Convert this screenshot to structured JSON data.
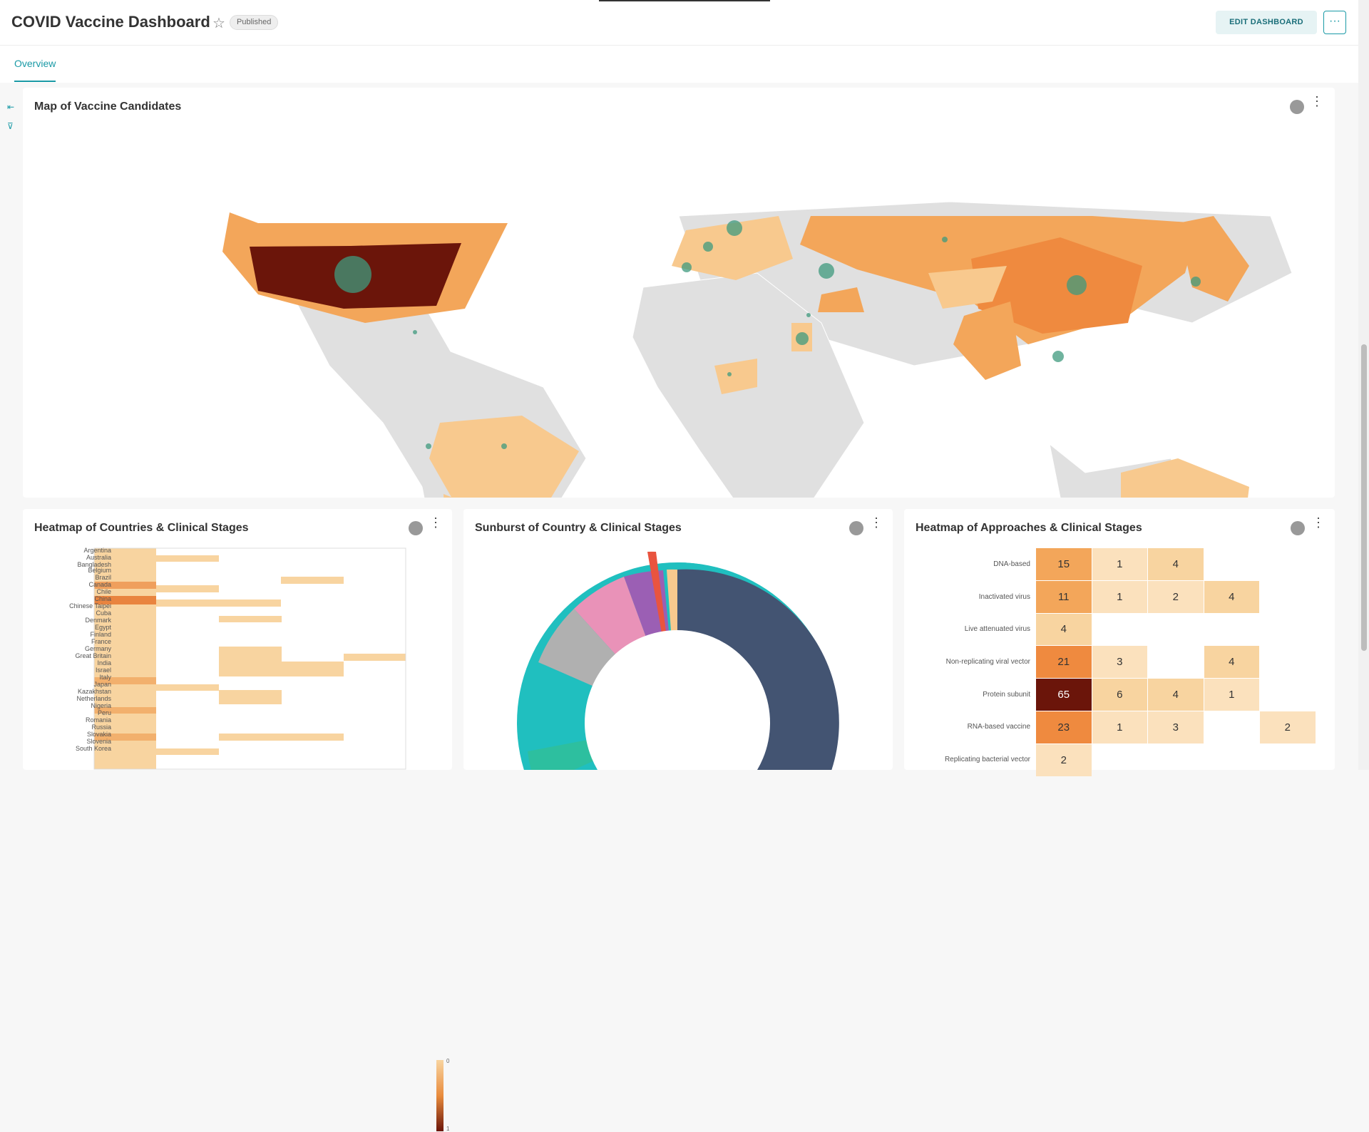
{
  "dashboard": {
    "title": "COVID Vaccine Dashboard",
    "status_badge": "Published",
    "edit_label": "EDIT DASHBOARD",
    "more_label": "···"
  },
  "tabs": [
    {
      "label": "Overview",
      "active": true
    }
  ],
  "charts": {
    "map": {
      "title": "Map of Vaccine Candidates"
    },
    "countries_heatmap": {
      "title": "Heatmap of Countries & Clinical Stages"
    },
    "sunburst": {
      "title": "Sunburst of Country & Clinical Stages"
    },
    "approaches_heatmap": {
      "title": "Heatmap of Approaches & Clinical Stages"
    }
  },
  "chart_data": [
    {
      "type": "heatmap",
      "title": "Heatmap of Countries & Clinical Stages",
      "rows": [
        "Argentina",
        "Australia",
        "Bangladesh",
        "Belgium",
        "Brazil",
        "Canada",
        "Chile",
        "China",
        "Chinese Taipei",
        "Cuba",
        "Denmark",
        "Egypt",
        "Finland",
        "France",
        "Germany",
        "Great Britain",
        "India",
        "Israel",
        "Italy",
        "Japan",
        "Kazakhstan",
        "Netherlands",
        "Nigeria",
        "Peru",
        "Romania",
        "Russia",
        "Slovakia",
        "Slovenia",
        "South Korea"
      ],
      "colorbar_ticks": [
        "0",
        "1"
      ]
    },
    {
      "type": "heatmap",
      "title": "Heatmap of Approaches & Clinical Stages",
      "rows": [
        "DNA-based",
        "Inactivated virus",
        "Live attenuated virus",
        "Non-replicating viral vector",
        "Protein subunit",
        "RNA-based vaccine",
        "Replicating bacterial vector"
      ],
      "values": [
        [
          15,
          1,
          4,
          null,
          null
        ],
        [
          11,
          1,
          2,
          4,
          null
        ],
        [
          4,
          null,
          null,
          null,
          null
        ],
        [
          21,
          3,
          null,
          4,
          null
        ],
        [
          65,
          6,
          4,
          1,
          null
        ],
        [
          23,
          1,
          3,
          null,
          2
        ],
        [
          2,
          null,
          null,
          null,
          null
        ]
      ]
    }
  ]
}
